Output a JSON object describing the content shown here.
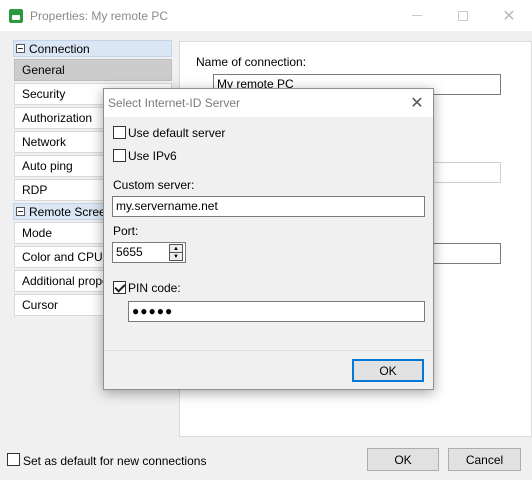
{
  "window": {
    "title": "Properties: My remote PC"
  },
  "sidebar": {
    "groups": [
      {
        "label": "Connection"
      },
      {
        "label": "Remote Screen"
      }
    ],
    "items": [
      {
        "label": "General"
      },
      {
        "label": "Security"
      },
      {
        "label": "Authorization"
      },
      {
        "label": "Network"
      },
      {
        "label": "Auto ping"
      },
      {
        "label": "RDP"
      },
      {
        "label": "Mode"
      },
      {
        "label": "Color and CPU"
      },
      {
        "label": "Additional properties"
      },
      {
        "label": "Cursor"
      }
    ],
    "selected": "General"
  },
  "general": {
    "name_label": "Name of connection:",
    "name_value": "My remote PC"
  },
  "footer": {
    "default_label": "Set as default for new connections",
    "default_checked": false,
    "ok_label": "OK",
    "cancel_label": "Cancel"
  },
  "dialog": {
    "title": "Select Internet-ID Server",
    "use_default_label": "Use default server",
    "use_default_checked": false,
    "use_ipv6_label": "Use IPv6",
    "use_ipv6_checked": false,
    "custom_server_label": "Custom server:",
    "custom_server_value": "my.servername.net",
    "port_label": "Port:",
    "port_value": "5655",
    "pin_label": "PIN code:",
    "pin_checked": true,
    "pin_value": "●●●●●",
    "ok_label": "OK"
  }
}
